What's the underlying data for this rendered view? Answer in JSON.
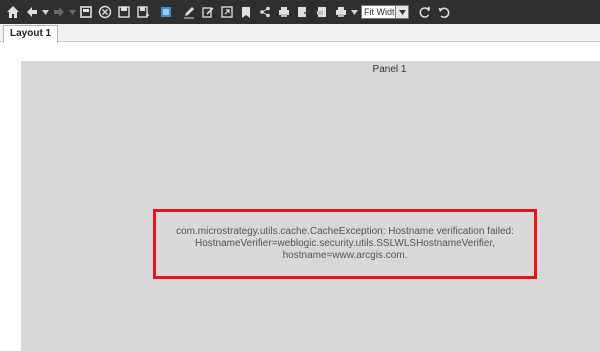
{
  "toolbar": {
    "icons": [
      "home-icon",
      "back-icon",
      "forward-icon",
      "present-icon",
      "close-icon",
      "save-icon",
      "save-as-icon",
      "data-icon",
      "edit-icon",
      "annotate-icon",
      "share-icon",
      "bookmark-icon",
      "share-link-icon",
      "print-icon",
      "export-icon",
      "pdf-icon",
      "more-print-icon",
      "refresh-icon",
      "reset-icon"
    ],
    "zoom": {
      "selected": "Fit Width"
    }
  },
  "tabs": [
    {
      "label": "Layout 1"
    }
  ],
  "panel": {
    "title": "Panel 1",
    "error": {
      "lines": [
        "com.microstrategy.utils.cache.CacheException: Hostname verification failed:",
        "HostnameVerifier=weblogic.security.utils.SSLWLSHostnameVerifier,",
        "hostname=www.arcgis.com."
      ]
    }
  },
  "colors": {
    "toolbar_bg": "#2f2f2f",
    "panel_bg": "#d8d8d8",
    "highlight": "#e8141b"
  }
}
